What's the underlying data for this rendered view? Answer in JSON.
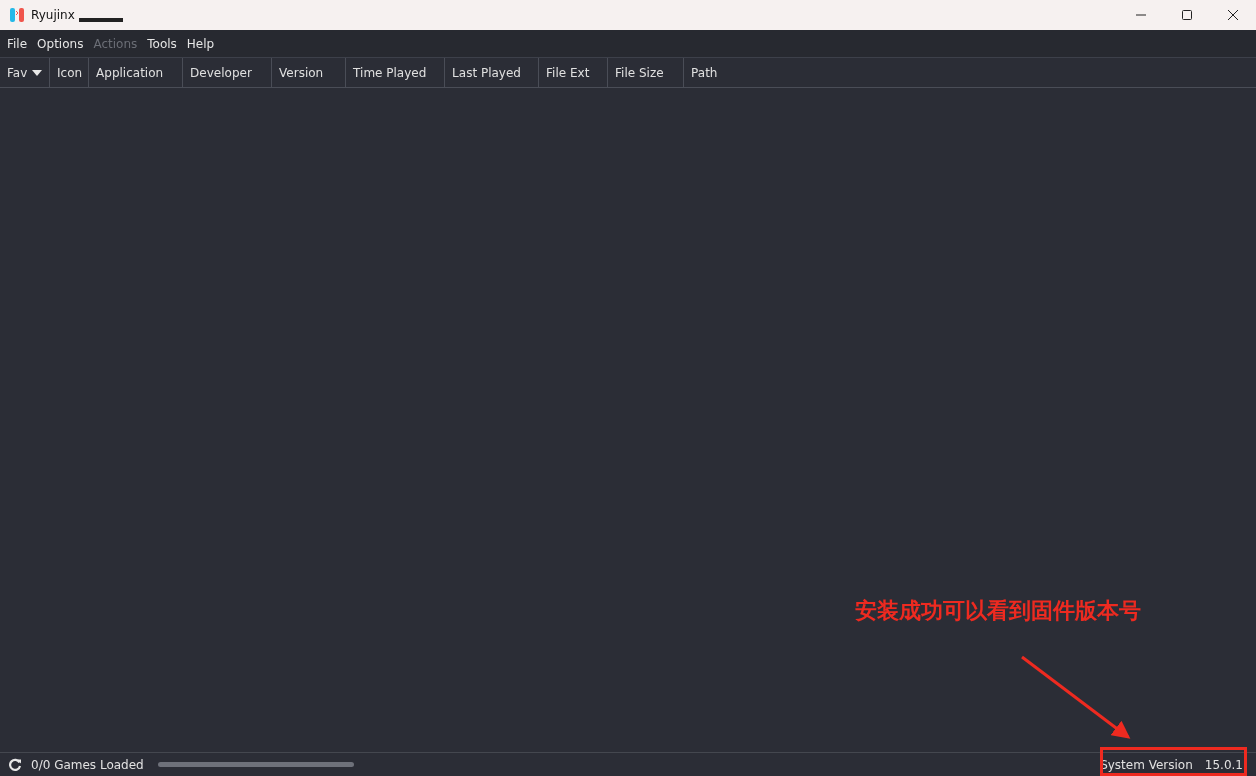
{
  "window": {
    "title": "Ryujinx"
  },
  "menu": [
    {
      "label": "File",
      "disabled": false
    },
    {
      "label": "Options",
      "disabled": false
    },
    {
      "label": "Actions",
      "disabled": true
    },
    {
      "label": "Tools",
      "disabled": false
    },
    {
      "label": "Help",
      "disabled": false
    }
  ],
  "table": {
    "columns": [
      {
        "label": "Fav",
        "sorted": true
      },
      {
        "label": "Icon",
        "sorted": false
      },
      {
        "label": "Application",
        "sorted": false
      },
      {
        "label": "Developer",
        "sorted": false
      },
      {
        "label": "Version",
        "sorted": false
      },
      {
        "label": "Time Played",
        "sorted": false
      },
      {
        "label": "Last Played",
        "sorted": false
      },
      {
        "label": "File Ext",
        "sorted": false
      },
      {
        "label": "File Size",
        "sorted": false
      },
      {
        "label": "Path",
        "sorted": false
      }
    ]
  },
  "status_bar": {
    "games_loaded": "0/0 Games Loaded",
    "progress": {
      "level": 1
    },
    "system_version_label": "System Version",
    "system_version": "15.0.1"
  },
  "annotation": {
    "text": "安装成功可以看到固件版本号"
  }
}
